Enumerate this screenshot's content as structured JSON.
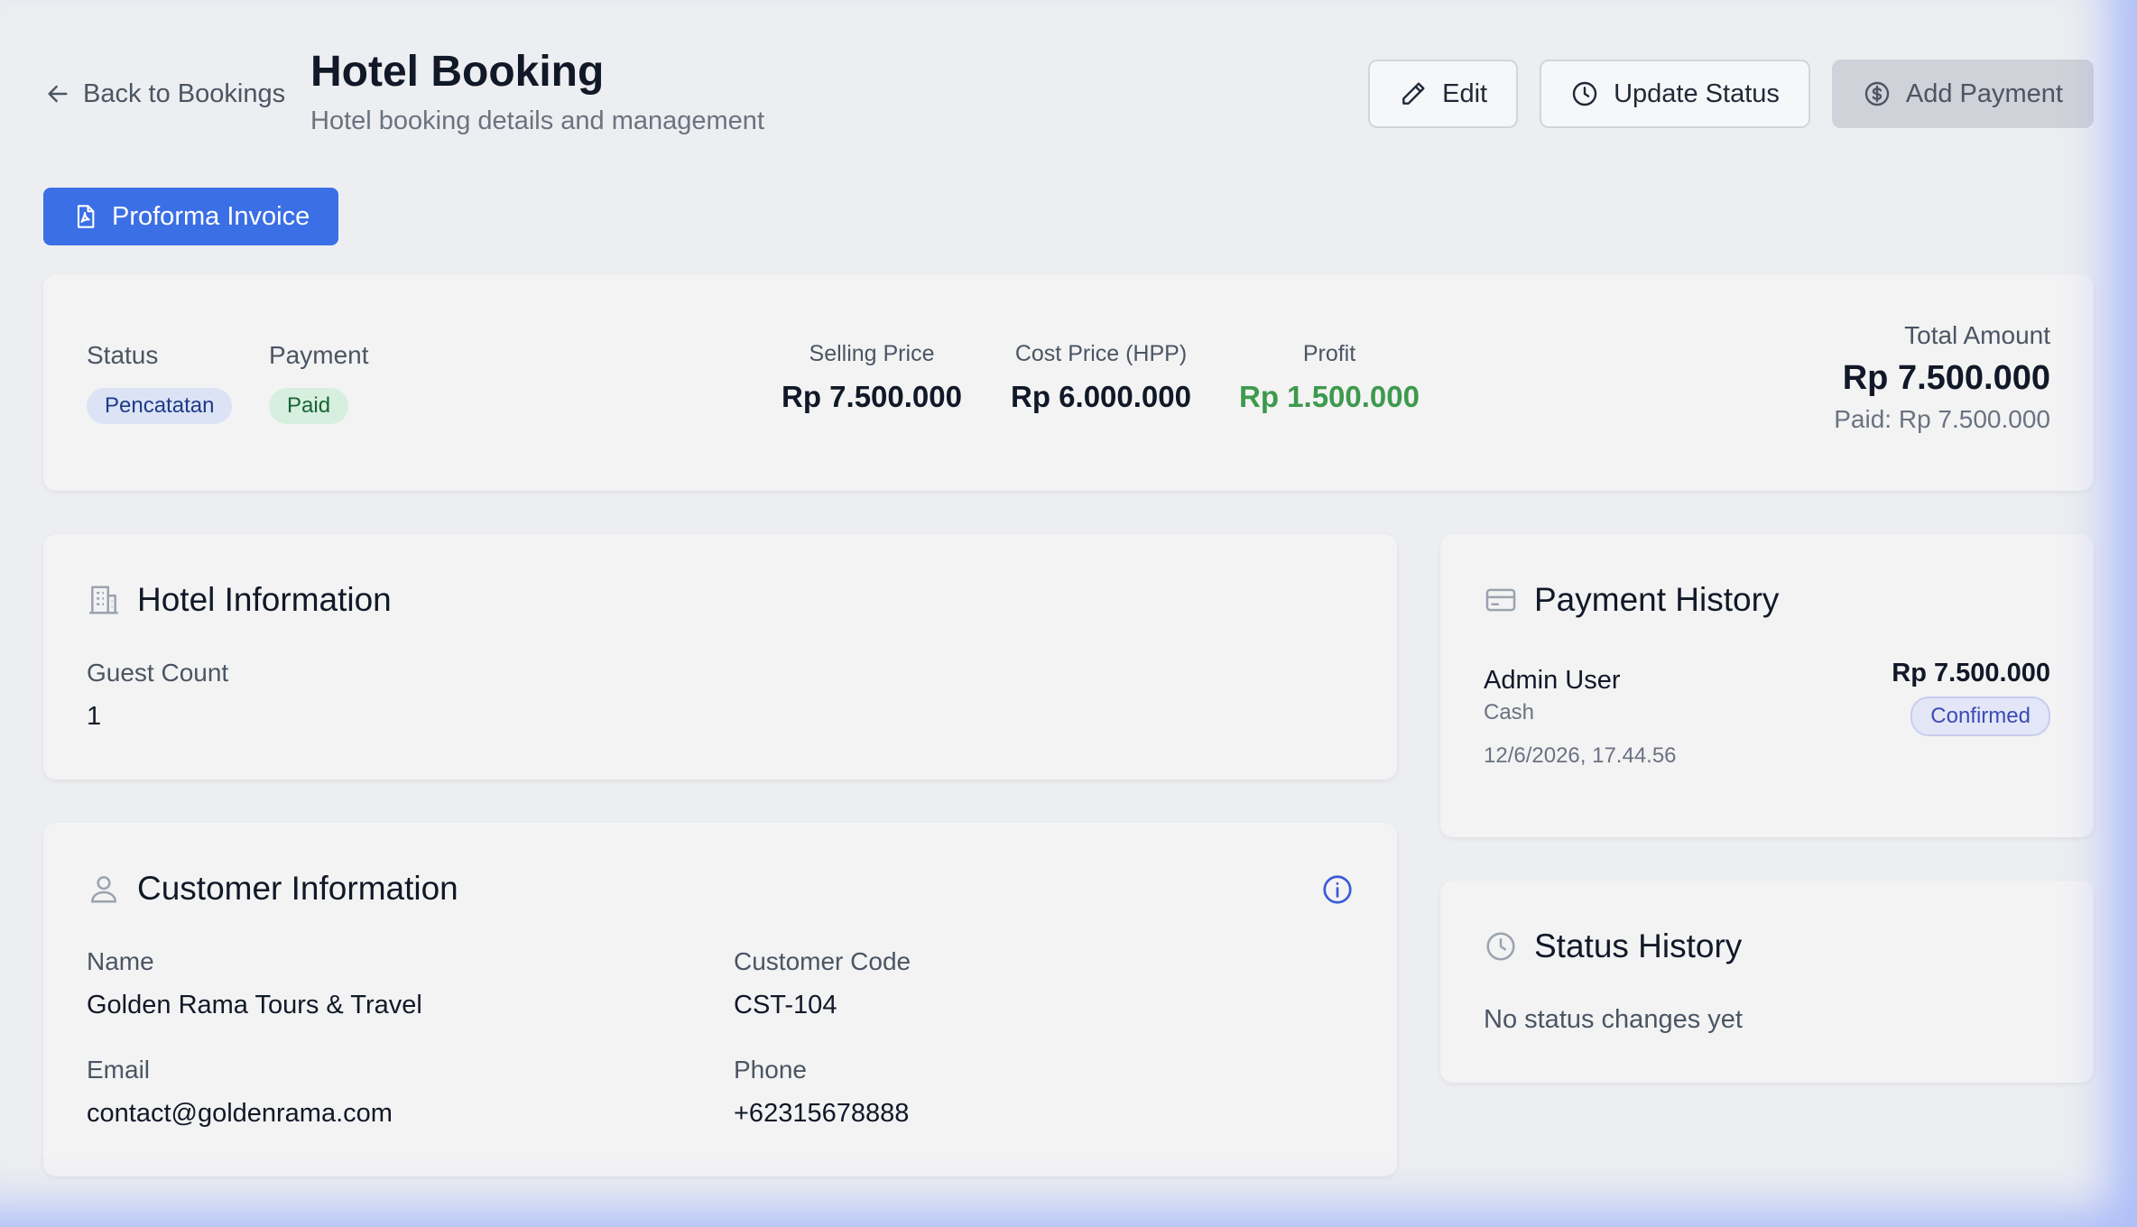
{
  "header": {
    "back_label": "Back to Bookings",
    "title": "Hotel Booking",
    "subtitle": "Hotel booking details and management",
    "actions": {
      "edit": "Edit",
      "update_status": "Update Status",
      "add_payment": "Add Payment"
    },
    "invoice_label": "Proforma Invoice"
  },
  "summary": {
    "status_label": "Status",
    "status_value": "Pencatatan",
    "payment_label": "Payment",
    "payment_value": "Paid",
    "selling_label": "Selling Price",
    "selling_value": "Rp 7.500.000",
    "cost_label": "Cost Price (HPP)",
    "cost_value": "Rp 6.000.000",
    "profit_label": "Profit",
    "profit_value": "Rp 1.500.000",
    "total_label": "Total Amount",
    "total_value": "Rp 7.500.000",
    "paid_line": "Paid: Rp 7.500.000"
  },
  "hotel": {
    "title": "Hotel Information",
    "guest_count_label": "Guest Count",
    "guest_count_value": "1"
  },
  "customer": {
    "title": "Customer Information",
    "name_label": "Name",
    "name_value": "Golden Rama Tours & Travel",
    "code_label": "Customer Code",
    "code_value": "CST-104",
    "email_label": "Email",
    "email_value": "contact@goldenrama.com",
    "phone_label": "Phone",
    "phone_value": "+62315678888"
  },
  "payment_history": {
    "title": "Payment History",
    "entries": [
      {
        "user": "Admin User",
        "method": "Cash",
        "timestamp": "12/6/2026, 17.44.56",
        "amount": "Rp 7.500.000",
        "status": "Confirmed"
      }
    ]
  },
  "status_history": {
    "title": "Status History",
    "empty": "No status changes yet"
  },
  "colors": {
    "primary": "#3b6fe6",
    "profit": "#3d9a4c",
    "status_badge_bg": "#dbe3f5",
    "paid_badge_bg": "#d7efdf"
  }
}
